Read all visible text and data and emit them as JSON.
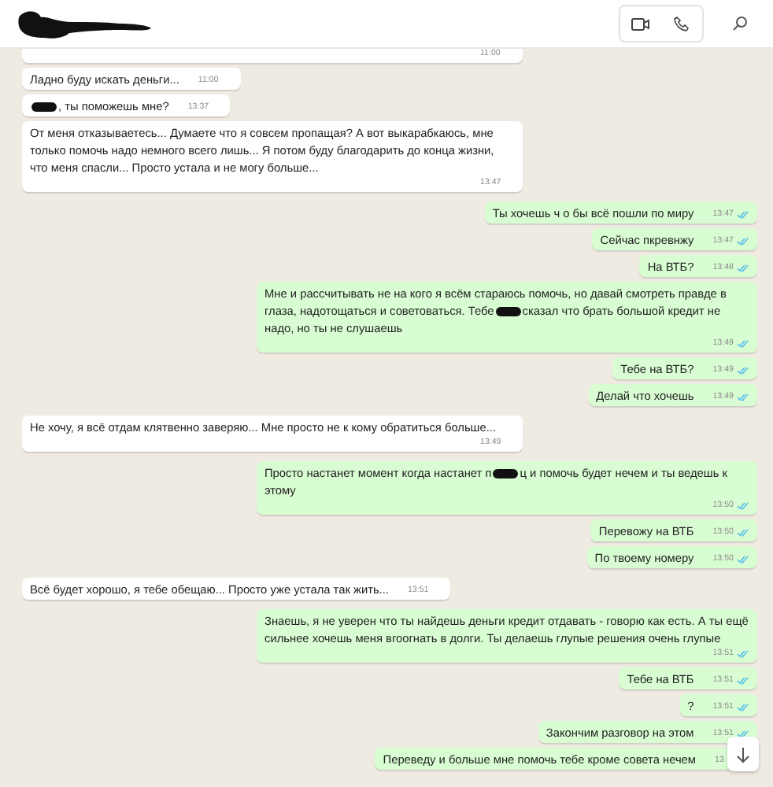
{
  "header": {
    "name_redacted": true
  },
  "messages": [
    {
      "incoming": true,
      "partial": true,
      "time": "11:00"
    },
    {
      "incoming": true,
      "parts": [
        {
          "kind": "text",
          "text": "Ладно буду искать деньги..."
        }
      ],
      "time": "11:00"
    },
    {
      "incoming": true,
      "parts": [
        {
          "kind": "redacted"
        },
        {
          "kind": "text",
          "text": ", ты поможешь мне?"
        }
      ],
      "time": "13:37"
    },
    {
      "incoming": true,
      "parts": [
        {
          "kind": "text",
          "text": "От меня отказываетесь... Думаете что я совсем пропащая? А вот выкарабкаюсь, мне только помочь надо немного всего лишь... Я потом буду благодарить до конца жизни, что меня спасли... Просто устала и не могу больше..."
        }
      ],
      "time": "13:47"
    },
    {
      "incoming": false,
      "read": true,
      "parts": [
        {
          "kind": "text",
          "text": "Ты хочешь ч о бы всё пошли по миру"
        }
      ],
      "time": "13:47"
    },
    {
      "incoming": false,
      "read": true,
      "parts": [
        {
          "kind": "text",
          "text": "Сейчас пкревнжу"
        }
      ],
      "time": "13:47"
    },
    {
      "incoming": false,
      "read": true,
      "parts": [
        {
          "kind": "text",
          "text": "На ВТБ?"
        }
      ],
      "time": "13:48"
    },
    {
      "incoming": false,
      "read": true,
      "parts": [
        {
          "kind": "text",
          "text": "Мне и рассчитывать не на кого я всём стараюсь помочь, но давай смотреть правде в глаза, надотощаться и советоваться. Тебе"
        },
        {
          "kind": "redacted"
        },
        {
          "kind": "text",
          "text": "сказал что брать большой кредит не надо, но ты не слушаешь"
        }
      ],
      "time": "13:49"
    },
    {
      "incoming": false,
      "read": true,
      "parts": [
        {
          "kind": "text",
          "text": "Тебе на ВТБ?"
        }
      ],
      "time": "13:49"
    },
    {
      "incoming": false,
      "read": true,
      "parts": [
        {
          "kind": "text",
          "text": "Делай что хочешь"
        }
      ],
      "time": "13:49"
    },
    {
      "incoming": true,
      "parts": [
        {
          "kind": "text",
          "text": "Не хочу, я всё отдам клятвенно заверяю... Мне просто не к кому обратиться больше..."
        }
      ],
      "time": "13:49"
    },
    {
      "incoming": false,
      "read": true,
      "parts": [
        {
          "kind": "text",
          "text": "Просто настанет момент когда настанет п"
        },
        {
          "kind": "redacted"
        },
        {
          "kind": "text",
          "text": "ц и помочь будет нечем и ты ведешь к этому"
        }
      ],
      "time": "13:50"
    },
    {
      "incoming": false,
      "read": true,
      "parts": [
        {
          "kind": "text",
          "text": "Перевожу на ВТБ"
        }
      ],
      "time": "13:50"
    },
    {
      "incoming": false,
      "read": true,
      "parts": [
        {
          "kind": "text",
          "text": "По твоему номеру"
        }
      ],
      "time": "13:50"
    },
    {
      "incoming": true,
      "parts": [
        {
          "kind": "text",
          "text": "Всё будет хорошо, я тебе обещаю... Просто уже устала так жить..."
        }
      ],
      "time": "13:51"
    },
    {
      "incoming": false,
      "read": true,
      "parts": [
        {
          "kind": "text",
          "text": "Знаешь, я не уверен что ты найдешь деньги кредит отдавать - говорю как есть. А ты ещё сильнее хочешь меня вгоогнать  в долги. Ты делаешь глупые решения очень глупые"
        }
      ],
      "time": "13:51"
    },
    {
      "incoming": false,
      "read": true,
      "parts": [
        {
          "kind": "text",
          "text": "Тебе на ВТБ"
        }
      ],
      "time": "13:51"
    },
    {
      "incoming": false,
      "read": true,
      "parts": [
        {
          "kind": "text",
          "text": "?"
        }
      ],
      "time": "13:51"
    },
    {
      "incoming": false,
      "read": true,
      "parts": [
        {
          "kind": "text",
          "text": "Закончим разговор на этом"
        }
      ],
      "time": "13:51"
    },
    {
      "incoming": false,
      "parts": [
        {
          "kind": "text",
          "text": "Переведу и больше мне помочь тебе кроме совета нечем"
        }
      ],
      "time": "13"
    }
  ]
}
